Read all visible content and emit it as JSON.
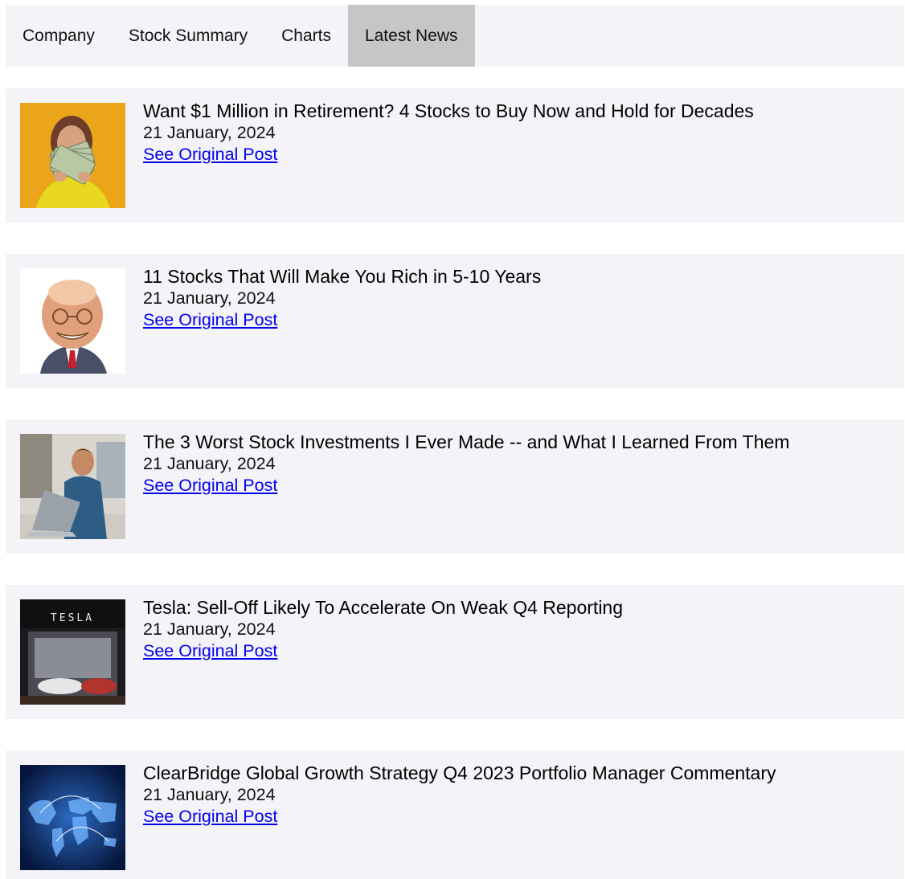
{
  "tabs": [
    {
      "label": "Company"
    },
    {
      "label": "Stock Summary"
    },
    {
      "label": "Charts"
    },
    {
      "label": "Latest News"
    }
  ],
  "news": [
    {
      "headline": "Want $1 Million in Retirement? 4 Stocks to Buy Now and Hold for Decades",
      "date": "21 January, 2024",
      "link_label": "See Original Post",
      "thumb_icon": "woman-with-cash-photo"
    },
    {
      "headline": "11 Stocks That Will Make You Rich in 5-10 Years",
      "date": "21 January, 2024",
      "link_label": "See Original Post",
      "thumb_icon": "caricature-man-photo"
    },
    {
      "headline": "The 3 Worst Stock Investments I Ever Made -- and What I Learned From Them",
      "date": "21 January, 2024",
      "link_label": "See Original Post",
      "thumb_icon": "stressed-man-laptop-photo"
    },
    {
      "headline": "Tesla: Sell-Off Likely To Accelerate On Weak Q4 Reporting",
      "date": "21 January, 2024",
      "link_label": "See Original Post",
      "thumb_icon": "tesla-store-photo",
      "thumb_text": "TESLA"
    },
    {
      "headline": "ClearBridge Global Growth Strategy Q4 2023 Portfolio Manager Commentary",
      "date": "21 January, 2024",
      "link_label": "See Original Post",
      "thumb_icon": "world-map-network-photo"
    }
  ],
  "colors": {
    "panel_bg": "#f4f3f8",
    "active_tab_bg": "#c6c6c6",
    "link": "#0000ee"
  }
}
